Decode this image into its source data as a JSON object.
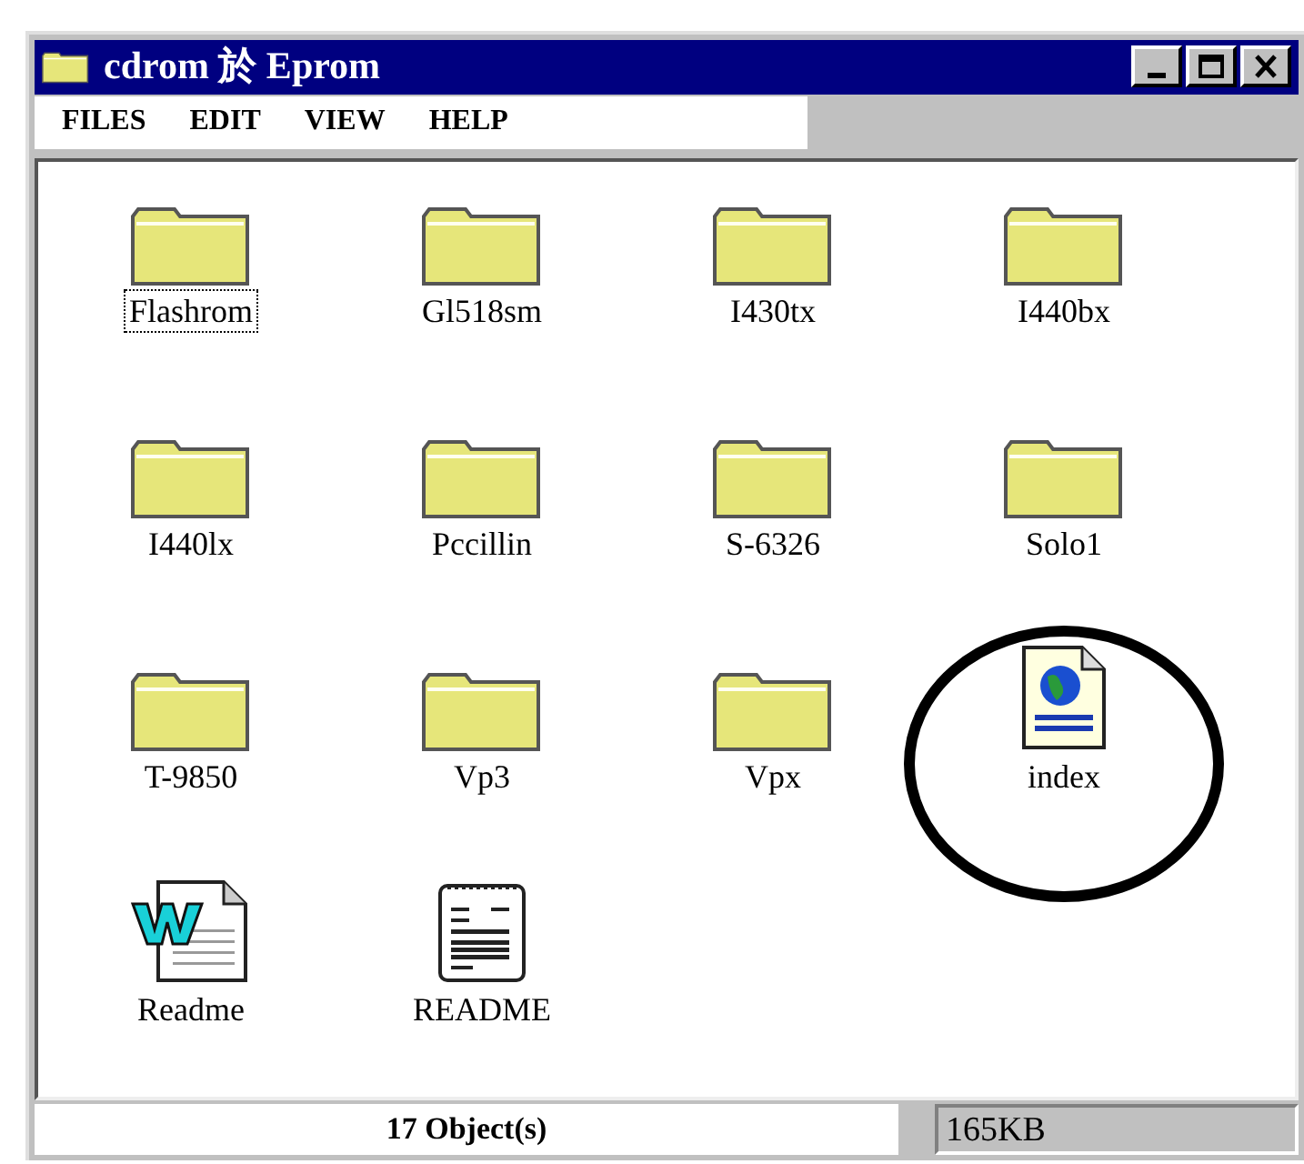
{
  "window": {
    "title": "cdrom 於 Eprom"
  },
  "menu": [
    "FILES",
    "EDIT",
    "VIEW",
    "HELP"
  ],
  "items": [
    {
      "label": "Flashrom",
      "kind": "folder",
      "selected": true,
      "circled": false
    },
    {
      "label": "Gl518sm",
      "kind": "folder",
      "selected": false,
      "circled": false
    },
    {
      "label": "I430tx",
      "kind": "folder",
      "selected": false,
      "circled": false
    },
    {
      "label": "I440bx",
      "kind": "folder",
      "selected": false,
      "circled": false
    },
    {
      "label": "I440lx",
      "kind": "folder",
      "selected": false,
      "circled": false
    },
    {
      "label": "Pccillin",
      "kind": "folder",
      "selected": false,
      "circled": false
    },
    {
      "label": "S-6326",
      "kind": "folder",
      "selected": false,
      "circled": false
    },
    {
      "label": "Solo1",
      "kind": "folder",
      "selected": false,
      "circled": false
    },
    {
      "label": "T-9850",
      "kind": "folder",
      "selected": false,
      "circled": false
    },
    {
      "label": "Vp3",
      "kind": "folder",
      "selected": false,
      "circled": false
    },
    {
      "label": "Vpx",
      "kind": "folder",
      "selected": false,
      "circled": false
    },
    {
      "label": "index",
      "kind": "webpage",
      "selected": false,
      "circled": true
    },
    {
      "label": "Readme",
      "kind": "document",
      "selected": false,
      "circled": false
    },
    {
      "label": "README",
      "kind": "textfile",
      "selected": false,
      "circled": false
    }
  ],
  "status_bar": {
    "objects": "17 Object(s)",
    "size": "165KB"
  }
}
